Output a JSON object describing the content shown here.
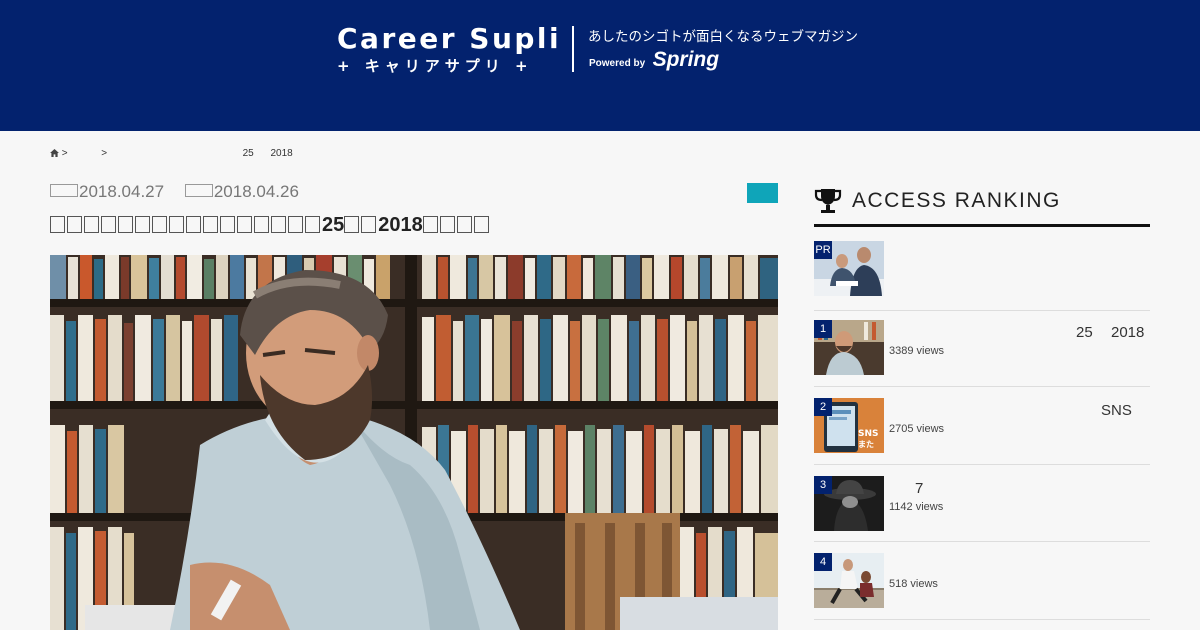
{
  "header": {
    "logo_en": "Career Supli",
    "logo_kana": "+ キャリアサプリ +",
    "tagline": "あしたのシゴトが面白くなるウェブマガジン",
    "powered_by": "Powered by",
    "powered_brand": "Spring",
    "bg_color": "#03226e"
  },
  "breadcrumb": {
    "home_icon": "home-icon",
    "sep1": ">",
    "sep2": ">",
    "part1": "25",
    "part2": "2018"
  },
  "article": {
    "updated": "2018.04.27",
    "published": "2018.04.26",
    "title_num1": "25",
    "title_num2": "2018",
    "category_color": "#0fa5b9"
  },
  "sidebar": {
    "ranking_icon": "trophy-icon",
    "ranking_title": "ACCESS RANKING",
    "items": [
      {
        "badge": "PR",
        "text1": "",
        "text2": "",
        "views": ""
      },
      {
        "badge": "1",
        "text1": "25",
        "text2": "2018",
        "views": "3389 views"
      },
      {
        "badge": "2",
        "text1": "SNS",
        "text2": "",
        "views": "2705 views"
      },
      {
        "badge": "3",
        "text1": "7",
        "text2": "",
        "views": "1142 views"
      },
      {
        "badge": "4",
        "text1": "",
        "text2": "",
        "views": "518 views"
      }
    ]
  }
}
